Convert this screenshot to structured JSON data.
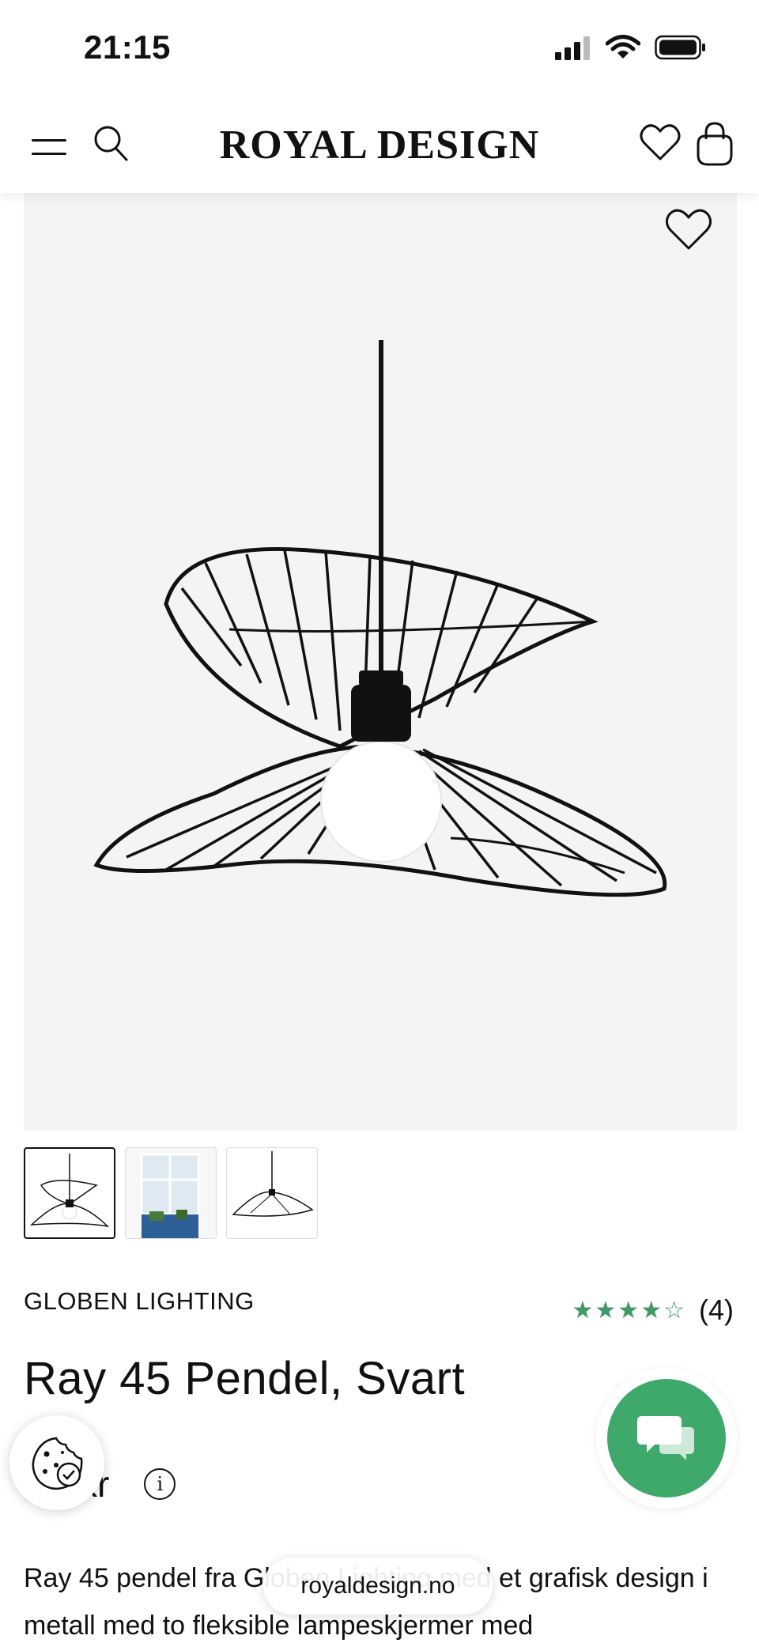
{
  "status_bar": {
    "time": "21:15"
  },
  "header": {
    "logo": "ROYAL DESIGN"
  },
  "product": {
    "brand": "GLOBEN LIGHTING",
    "rating_stars": "★★★★☆",
    "rating_count": "(4)",
    "title": "Ray 45 Pendel, Svart",
    "price": "kr",
    "info_symbol": "i",
    "description": "Ray 45 pendel fra Globen Lighting med et grafisk design i metall med to fleksible lampeskjermer med"
  },
  "browser": {
    "url": "royaldesign.no"
  },
  "colors": {
    "accent_green": "#3ea96b",
    "star_green": "#3f9a65"
  },
  "icons": [
    "menu-icon",
    "search-icon",
    "heart-icon",
    "bag-icon",
    "cookie-icon",
    "chat-icon",
    "info-icon"
  ]
}
